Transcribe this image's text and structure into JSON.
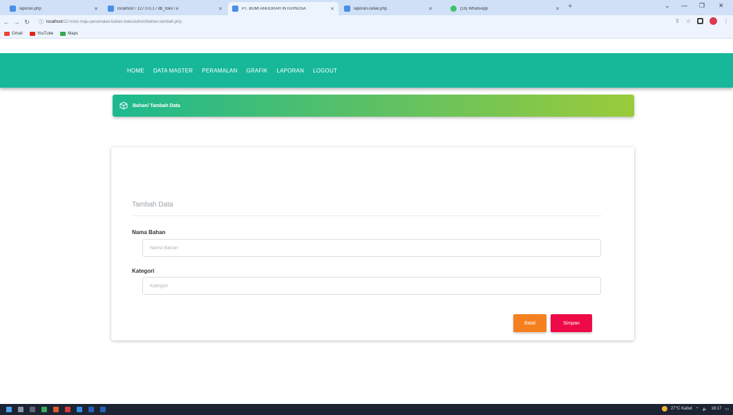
{
  "browser": {
    "tabs": [
      {
        "title": "laporan.php",
        "active": false
      },
      {
        "title": "localhost / 127.0.0.1 / db_toko / e",
        "active": false
      },
      {
        "title": "PT. BUMI ANUGRAH INTERNUSA",
        "active": true
      },
      {
        "title": "laporan-cetak.php",
        "active": false
      },
      {
        "title": "(16) WhatsApp",
        "active": false
      }
    ],
    "url_host": "localhost",
    "url_path": "/22-hoist-maju-peramalan-bahan-baku/admin/bahan-tambah.php",
    "bookmarks": [
      "Gmail",
      "YouTube",
      "Maps"
    ]
  },
  "navbar": {
    "items": [
      "HOME",
      "DATA MASTER",
      "PERAMALAN",
      "GRAFIK",
      "LAPORAN",
      "LOGOUT"
    ]
  },
  "banner": {
    "title": "Bahan/ Tambah Data"
  },
  "form": {
    "title": "Tambah Data",
    "nama_label": "Nama Bahan",
    "nama_placeholder": "Nama Bahan",
    "kategori_label": "Kategori",
    "kategori_placeholder": "Kategori",
    "cancel_label": "Batal",
    "save_label": "Simpan"
  },
  "taskbar": {
    "weather": "27°C Kabut",
    "clock": "18:17"
  },
  "colors": {
    "navbar": "#17b89a",
    "banner_start": "#1cb98f",
    "banner_end": "#9acb3a",
    "cancel": "#f5801f",
    "save": "#ee0a47"
  }
}
